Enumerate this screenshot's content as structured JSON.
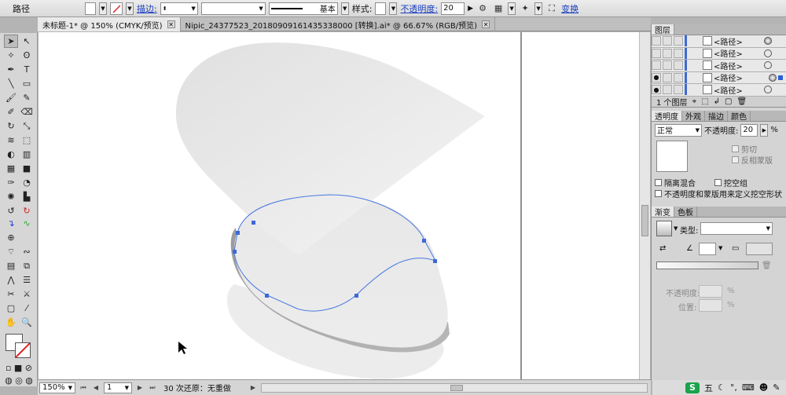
{
  "control_bar": {
    "object_type": "路径",
    "stroke_label": "描边:",
    "stroke_style": "基本",
    "style_label": "样式:",
    "opacity_label": "不透明度:",
    "opacity_value": "20",
    "transform_label": "变换"
  },
  "document_tabs": [
    {
      "label": "未标题-1* @ 150% (CMYK/预览)",
      "active": true
    },
    {
      "label": "Nipic_24377523_20180909161435338000 [转换].ai* @ 66.67% (RGB/预览)",
      "active": false
    }
  ],
  "layers_panel": {
    "tab": "图层",
    "rows": [
      {
        "label": "<路径>",
        "visible": false,
        "targeted": true
      },
      {
        "label": "<路径>",
        "visible": false,
        "targeted": false
      },
      {
        "label": "<路径>",
        "visible": false,
        "targeted": false
      },
      {
        "label": "<路径>",
        "visible": true,
        "targeted": true,
        "selected": true
      },
      {
        "label": "<路径>",
        "visible": true,
        "targeted": false
      }
    ],
    "footer": "1 个图层"
  },
  "transparency_panel": {
    "tabs": [
      "透明度",
      "外观",
      "描边",
      "颜色"
    ],
    "blend_mode": "正常",
    "opacity_label": "不透明度:",
    "opacity_value": "20",
    "clip_label": "剪切",
    "invert_mask_label": "反相蒙版",
    "isolate_blending": "隔离混合",
    "knockout_group": "挖空组",
    "opacity_mask_text": "不透明度和蒙版用来定义挖空形状"
  },
  "gradient_panel": {
    "tabs": [
      "渐变",
      "色板"
    ],
    "type_label": "类型:",
    "opacity_label": "不透明度:",
    "location_label": "位置:",
    "percent": "%"
  },
  "status_bar": {
    "zoom": "150%",
    "artboard": "1",
    "history": "30 次还原：无重做"
  },
  "taskbar_ime": {
    "s_logo": "S",
    "mode": "五"
  },
  "colors": {
    "path_blue": "#4a78e0",
    "anchor_blue": "#3d68d8",
    "accent": "#1a3fbf"
  }
}
